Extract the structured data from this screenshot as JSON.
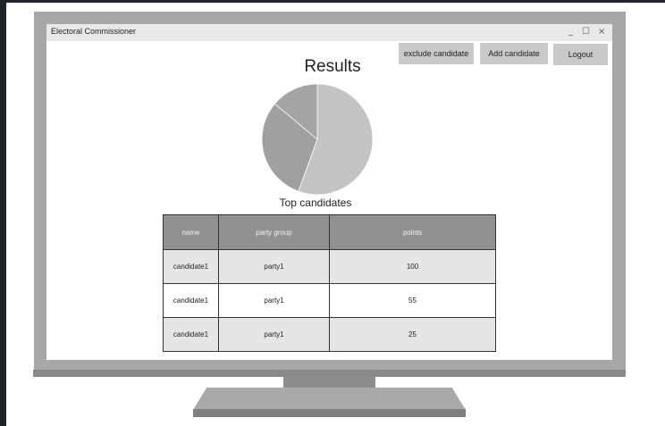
{
  "window": {
    "title": "Electoral Commissioner",
    "controls": {
      "minimize": "_",
      "maximize": "☐",
      "close": "×"
    }
  },
  "toolbar": {
    "exclude_label": "exclude candidate",
    "add_label": "Add candidate",
    "logout_label": "Logout"
  },
  "main": {
    "title": "Results",
    "table_title": "Top candidates"
  },
  "chart_data": {
    "type": "pie",
    "title": "",
    "values": [
      100,
      55,
      25
    ],
    "slice_colors": [
      "#c4c4c4",
      "#a0a0a0",
      "#a4a4a4"
    ],
    "extra_slice_colors": [
      "#b0b0b0"
    ]
  },
  "table": {
    "columns": [
      "name",
      "party group",
      "points"
    ],
    "rows": [
      {
        "name": "candidate1",
        "party": "party1",
        "points": "100"
      },
      {
        "name": "candidate1",
        "party": "party1",
        "points": "55"
      },
      {
        "name": "candidate1",
        "party": "party1",
        "points": "25"
      }
    ]
  },
  "colors": {
    "page_bg": "#1f2328",
    "monitor_bezel": "#a7a7a7",
    "button_bg": "#c9c9c9",
    "table_header_bg": "#919191",
    "row_shade": "#e6e6e6"
  }
}
